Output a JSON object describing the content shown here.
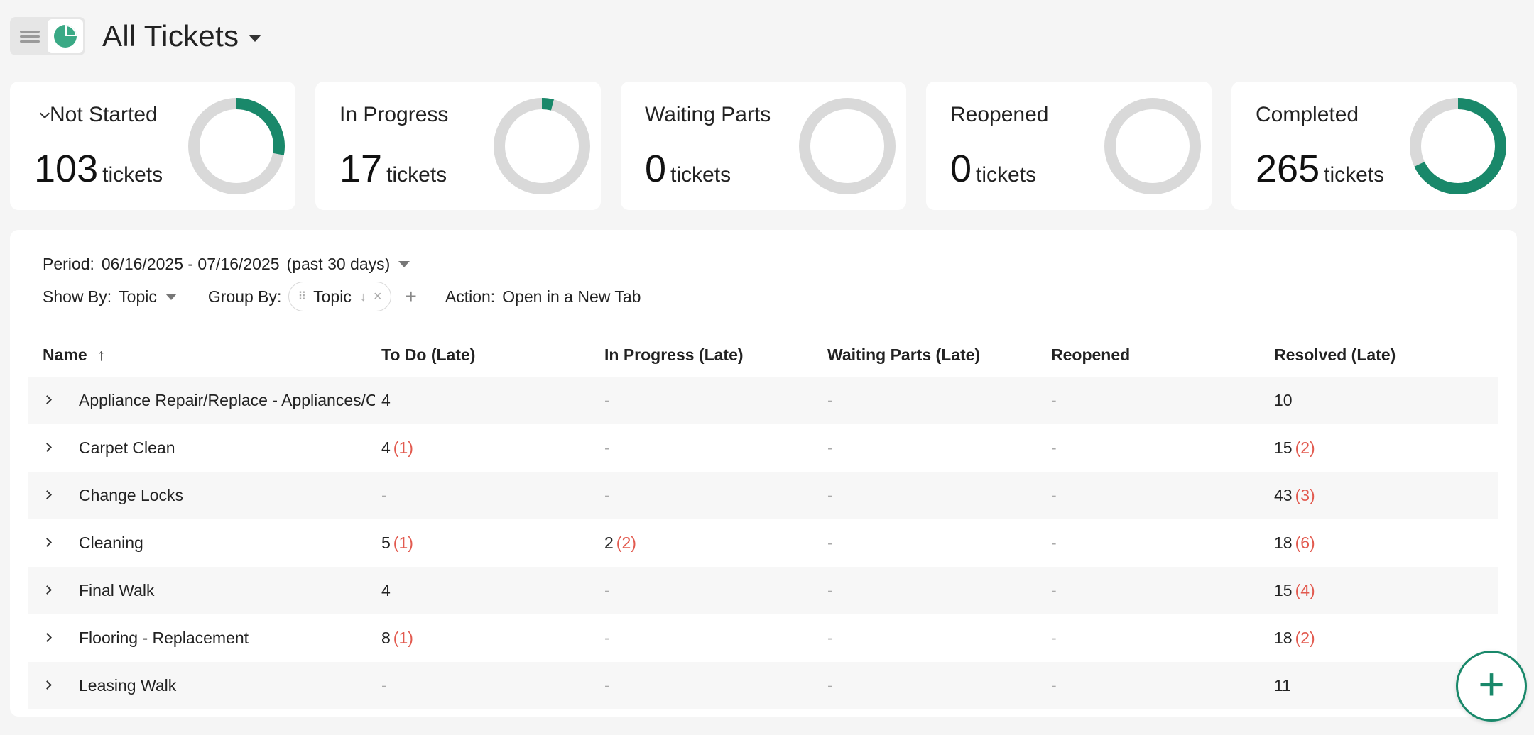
{
  "header": {
    "title": "All Tickets"
  },
  "accent": "#19886a",
  "cards": [
    {
      "label": "Not Started",
      "count": "103",
      "unit": "tickets",
      "progress": 0.28
    },
    {
      "label": "In Progress",
      "count": "17",
      "unit": "tickets",
      "progress": 0.04
    },
    {
      "label": "Waiting Parts",
      "count": "0",
      "unit": "tickets",
      "progress": 0
    },
    {
      "label": "Reopened",
      "count": "0",
      "unit": "tickets",
      "progress": 0
    },
    {
      "label": "Completed",
      "count": "265",
      "unit": "tickets",
      "progress": 0.68
    }
  ],
  "filters": {
    "period_label": "Period:",
    "period_value": "06/16/2025 - 07/16/2025",
    "period_note": "(past 30 days)",
    "show_by_label": "Show By:",
    "show_by_value": "Topic",
    "group_by_label": "Group By:",
    "group_by_chip": "Topic",
    "action_label": "Action:",
    "action_value": "Open in a New Tab"
  },
  "table": {
    "columns": [
      "Name",
      "To Do (Late)",
      "In Progress (Late)",
      "Waiting Parts (Late)",
      "Reopened",
      "Resolved (Late)"
    ],
    "rows": [
      {
        "name": "Appliance Repair/Replace - Appliances/Coo",
        "todo": "4",
        "todo_late": "",
        "inprog": "-",
        "inprog_late": "",
        "waiting": "-",
        "reopened": "-",
        "resolved": "10",
        "resolved_late": ""
      },
      {
        "name": "Carpet Clean",
        "todo": "4",
        "todo_late": "(1)",
        "inprog": "-",
        "inprog_late": "",
        "waiting": "-",
        "reopened": "-",
        "resolved": "15",
        "resolved_late": "(2)"
      },
      {
        "name": "Change Locks",
        "todo": "-",
        "todo_late": "",
        "inprog": "-",
        "inprog_late": "",
        "waiting": "-",
        "reopened": "-",
        "resolved": "43",
        "resolved_late": "(3)"
      },
      {
        "name": "Cleaning",
        "todo": "5",
        "todo_late": "(1)",
        "inprog": "2",
        "inprog_late": "(2)",
        "waiting": "-",
        "reopened": "-",
        "resolved": "18",
        "resolved_late": "(6)"
      },
      {
        "name": "Final Walk",
        "todo": "4",
        "todo_late": "",
        "inprog": "-",
        "inprog_late": "",
        "waiting": "-",
        "reopened": "-",
        "resolved": "15",
        "resolved_late": "(4)"
      },
      {
        "name": "Flooring - Replacement",
        "todo": "8",
        "todo_late": "(1)",
        "inprog": "-",
        "inprog_late": "",
        "waiting": "-",
        "reopened": "-",
        "resolved": "18",
        "resolved_late": "(2)"
      },
      {
        "name": "Leasing Walk",
        "todo": "-",
        "todo_late": "",
        "inprog": "-",
        "inprog_late": "",
        "waiting": "-",
        "reopened": "-",
        "resolved": "11",
        "resolved_late": ""
      }
    ]
  }
}
